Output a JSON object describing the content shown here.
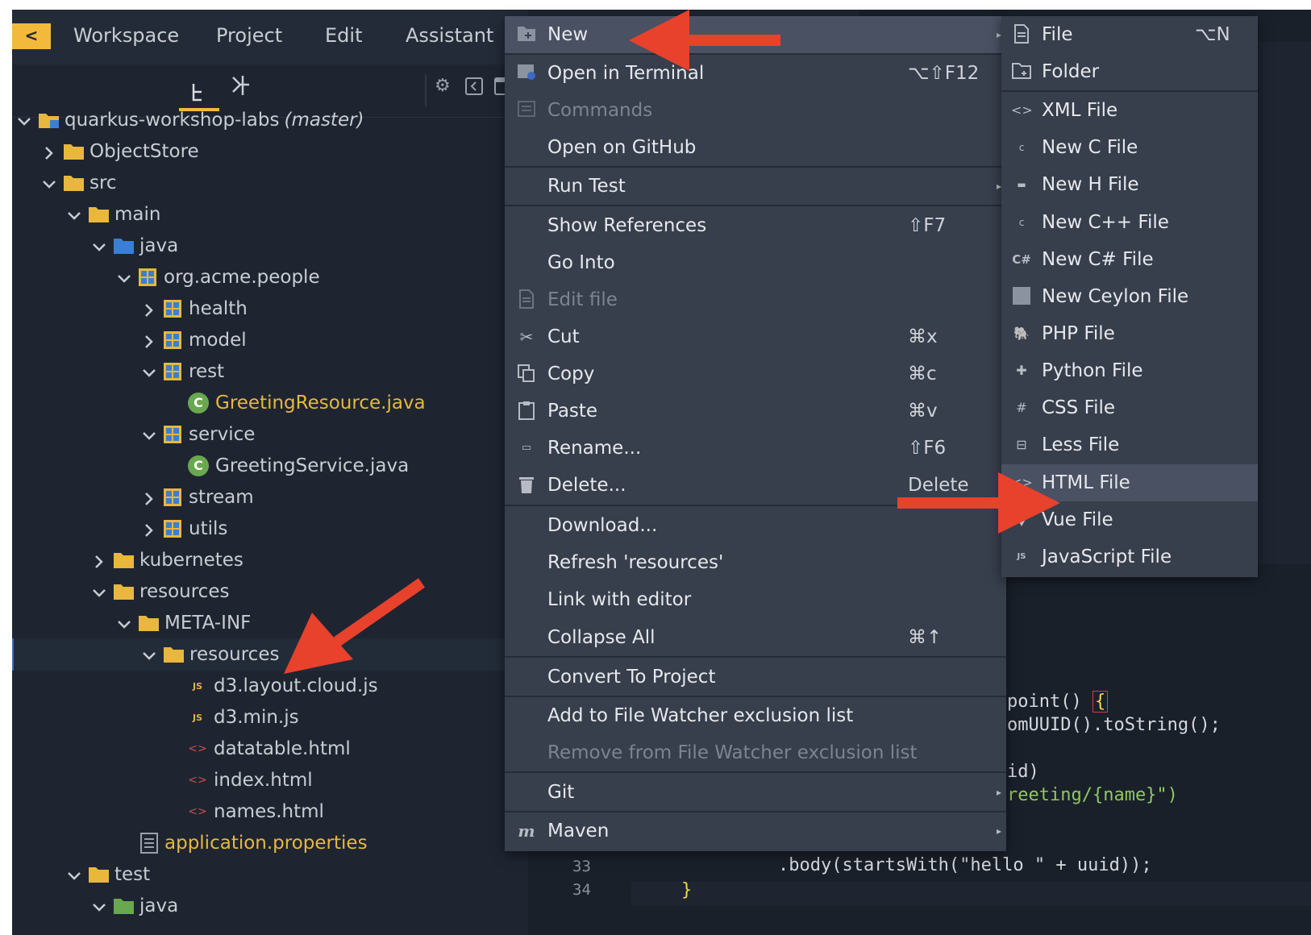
{
  "menubar": {
    "back_label": "<",
    "items": [
      "Workspace",
      "Project",
      "Edit",
      "Assistant"
    ]
  },
  "tree": {
    "rows": [
      {
        "label": "quarkus-workshop-labs",
        "suffix": "(master)"
      },
      {
        "label": "ObjectStore"
      },
      {
        "label": "src"
      },
      {
        "label": "main"
      },
      {
        "label": "java"
      },
      {
        "label": "org.acme.people"
      },
      {
        "label": "health"
      },
      {
        "label": "model"
      },
      {
        "label": "rest"
      },
      {
        "label": "GreetingResource.java"
      },
      {
        "label": "service"
      },
      {
        "label": "GreetingService.java"
      },
      {
        "label": "stream"
      },
      {
        "label": "utils"
      },
      {
        "label": "kubernetes"
      },
      {
        "label": "resources"
      },
      {
        "label": "META-INF"
      },
      {
        "label": "resources"
      },
      {
        "label": "d3.layout.cloud.js"
      },
      {
        "label": "d3.min.js"
      },
      {
        "label": "datatable.html"
      },
      {
        "label": "index.html"
      },
      {
        "label": "names.html"
      },
      {
        "label": "application.properties"
      },
      {
        "label": "test"
      },
      {
        "label": "java"
      }
    ],
    "js_badge": "JS"
  },
  "editor": {
    "lines": [
      {
        "text": "point() "
      },
      {
        "text": "omUUID().toString();"
      },
      {
        "text": "id)"
      },
      {
        "text": "reeting/{name}\")"
      },
      {
        "text": ".body(startsWith(\"hello \" + uuid));"
      },
      {
        "text": "}"
      }
    ],
    "brace": "{",
    "line_numbers": [
      "33",
      "34"
    ]
  },
  "context_menu": {
    "items": [
      {
        "label": "New",
        "shortcut": ""
      },
      {
        "label": "Open in Terminal",
        "shortcut": "⌥⇧F12"
      },
      {
        "label": "Commands",
        "shortcut": ""
      },
      {
        "label": "Open on GitHub",
        "shortcut": ""
      },
      {
        "label": "Run Test",
        "shortcut": ""
      },
      {
        "label": "Show References",
        "shortcut": "⇧F7"
      },
      {
        "label": "Go Into",
        "shortcut": ""
      },
      {
        "label": "Edit file",
        "shortcut": ""
      },
      {
        "label": "Cut",
        "shortcut": "⌘x"
      },
      {
        "label": "Copy",
        "shortcut": "⌘c"
      },
      {
        "label": "Paste",
        "shortcut": "⌘v"
      },
      {
        "label": "Rename...",
        "shortcut": "⇧F6"
      },
      {
        "label": "Delete...",
        "shortcut": "Delete"
      },
      {
        "label": "Download...",
        "shortcut": ""
      },
      {
        "label": "Refresh 'resources'",
        "shortcut": ""
      },
      {
        "label": "Link with editor",
        "shortcut": ""
      },
      {
        "label": "Collapse All",
        "shortcut": "⌘↑"
      },
      {
        "label": "Convert To Project",
        "shortcut": ""
      },
      {
        "label": "Add to File Watcher exclusion list",
        "shortcut": ""
      },
      {
        "label": "Remove from File Watcher exclusion list",
        "shortcut": ""
      },
      {
        "label": "Git",
        "shortcut": ""
      },
      {
        "label": "Maven",
        "shortcut": ""
      }
    ],
    "submenu_arrow": "▸"
  },
  "new_submenu": {
    "items": [
      {
        "label": "File",
        "shortcut": "⌥N"
      },
      {
        "label": "Folder",
        "shortcut": ""
      },
      {
        "label": "XML File",
        "shortcut": ""
      },
      {
        "label": "New C File",
        "shortcut": ""
      },
      {
        "label": "New H File",
        "shortcut": ""
      },
      {
        "label": "New C++ File",
        "shortcut": ""
      },
      {
        "label": "New C# File",
        "shortcut": ""
      },
      {
        "label": "New Ceylon File",
        "shortcut": ""
      },
      {
        "label": "PHP File",
        "shortcut": ""
      },
      {
        "label": "Python File",
        "shortcut": ""
      },
      {
        "label": "CSS File",
        "shortcut": ""
      },
      {
        "label": "Less File",
        "shortcut": ""
      },
      {
        "label": "HTML File",
        "shortcut": ""
      },
      {
        "label": "Vue File",
        "shortcut": ""
      },
      {
        "label": "JavaScript File",
        "shortcut": ""
      }
    ],
    "icons": {
      "xml": "<>",
      "c": "c",
      "csharp": "C#",
      "php": "🐘",
      "css": "#",
      "js": "JS",
      "maven": "m"
    }
  },
  "colors": {
    "accent": "#f2b93b",
    "annotation_arrow": "#e8412c",
    "java_class": "#6aa84f",
    "folder": "#e8b73c",
    "java_folder": "#3a7fd5"
  }
}
